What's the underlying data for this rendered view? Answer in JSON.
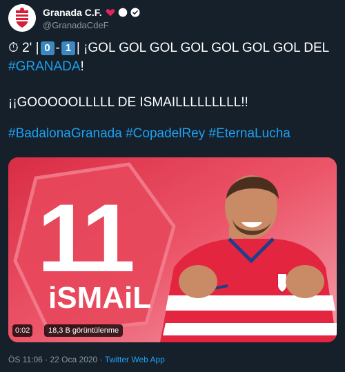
{
  "author": {
    "display_name": "Granada C.F.",
    "handle": "@GranadaCdeF"
  },
  "tweet": {
    "line1_minute": "2'",
    "score_home": "0",
    "score_away": "1",
    "line1_text": "¡GOL GOL GOL GOL GOL GOL GOL DEL",
    "line2_hashtag": "#GRANADA",
    "line2_suffix": "!",
    "line3": "¡¡GOOOOOLLLLL DE ISMAILLLLLLLLL!!",
    "hashtags": [
      "#BadalonaGranada",
      "#CopadelRey",
      "#EternaLucha"
    ]
  },
  "media": {
    "jersey_number": "11",
    "player_name": "iSMAiL",
    "elapsed": "0:02",
    "views": "18,3 B görüntülenme"
  },
  "footer": {
    "time": "ÖS 11:06",
    "separator": "·",
    "date": "22 Oca 2020",
    "source": "Twitter Web App"
  },
  "colors": {
    "background": "#15202b",
    "accent": "#1da1f2",
    "muted": "#8899a6",
    "keycap": "#3b88c3",
    "heart": "#e0245e",
    "video_bg": "#e63950"
  }
}
